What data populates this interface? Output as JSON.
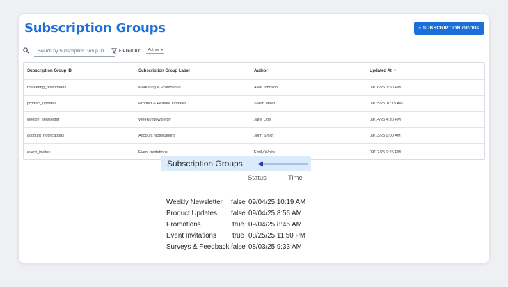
{
  "page": {
    "title": "Subscription Groups",
    "add_button_label": "+ SUBSCRIPTION GROUP"
  },
  "toolbar": {
    "search_placeholder": "Search by Subscription Group ID",
    "filter_label": "FILTER BY:",
    "filter_value": "Author",
    "search_icon": "search-icon",
    "filter_icon": "funnel-icon"
  },
  "table": {
    "headers": [
      "Subscription Group ID",
      "Subscription Group Label",
      "Author",
      "Updated At"
    ],
    "sort_indicator": "▼",
    "rows": [
      [
        "marketing_promotions",
        "Marketing & Promotions",
        "Alex Johnson",
        "09/16/25 1:50 PM"
      ],
      [
        "product_updates",
        "Product & Feature Updates",
        "Sarah Miller",
        "09/15/25 10:15 AM"
      ],
      [
        "weekly_newsletter",
        "Weekly Newsletter",
        "Jane Doe",
        "09/14/25 4:30 PM"
      ],
      [
        "account_notifications",
        "Account Notifications",
        "John Smith",
        "09/13/25 9:00 AM"
      ],
      [
        "event_invites",
        "Event Invitations",
        "Emily White",
        "09/12/25 2:25 PM"
      ]
    ]
  },
  "inset": {
    "title": "Subscription Groups",
    "col_status": "Status",
    "col_time": "Time",
    "rows": [
      [
        "Weekly Newsletter",
        "false",
        "09/04/25 10:19 AM"
      ],
      [
        "Product Updates",
        "false",
        "09/04/25 8:56 AM"
      ],
      [
        "Promotions",
        "true",
        "09/04/25 8:45 AM"
      ],
      [
        "Event Invitations",
        "true",
        "08/25/25 11:50 PM"
      ],
      [
        "Surveys & Feedback",
        "false",
        "08/03/25 9:33 AM"
      ]
    ]
  },
  "colors": {
    "accent": "#1e6fd9",
    "button": "#1b6fd8",
    "inset_highlight": "#dcebfa",
    "arrow": "#1f3fbf"
  }
}
